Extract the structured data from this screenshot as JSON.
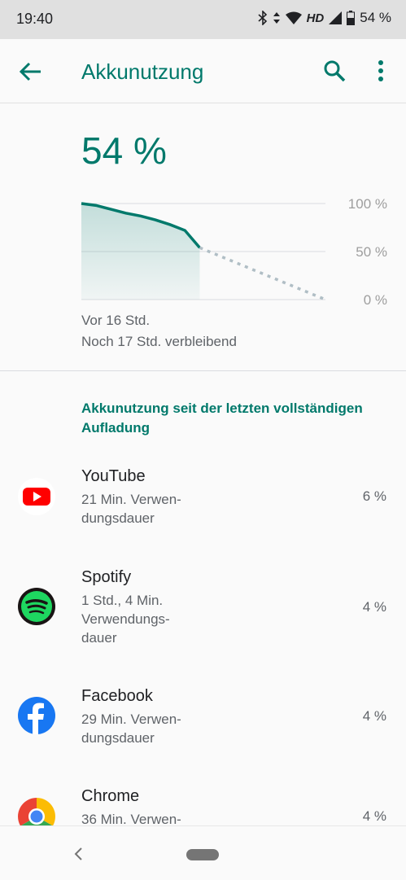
{
  "status_bar": {
    "time": "19:40",
    "hd": "HD",
    "battery": "54 %"
  },
  "app_bar": {
    "title": "Akkunutzung",
    "back_icon": "arrow-back-icon",
    "search_icon": "search-icon",
    "more_icon": "more-vert-icon"
  },
  "battery": {
    "level": "54 %",
    "chart_since": "Vor 16 Std.",
    "chart_remaining": "Noch 17 Std. verbleibend",
    "y_ticks": [
      "100 %",
      "50 %",
      "0 %"
    ]
  },
  "chart_data": {
    "type": "line",
    "x": [
      0,
      2,
      4,
      6,
      8,
      10,
      12,
      14,
      16,
      33
    ],
    "series": [
      {
        "values": [
          100,
          98,
          94,
          90,
          87,
          83,
          78,
          72,
          54,
          null
        ]
      },
      {
        "values": [
          null,
          null,
          null,
          null,
          null,
          null,
          null,
          null,
          54,
          0
        ]
      }
    ],
    "ylim": [
      0,
      100
    ],
    "y_ticks": [
      "100 %",
      "50 %",
      "0 %"
    ],
    "xlabel": "Vor 16 Std.",
    "grid": true
  },
  "usage": {
    "section_title": "Akkunutzung seit der letzten vollständigen Aufladung",
    "apps": [
      {
        "name": "YouTube",
        "sub": "21 Min. Verwen-dungsdauer",
        "percent": "6 %",
        "icon": "youtube-icon"
      },
      {
        "name": "Spotify",
        "sub": "1 Std., 4 Min. Verwendungs-dauer",
        "percent": "4 %",
        "icon": "spotify-icon"
      },
      {
        "name": "Facebook",
        "sub": "29 Min. Verwen-dungsdauer",
        "percent": "4 %",
        "icon": "facebook-icon"
      },
      {
        "name": "Chrome",
        "sub": "36 Min. Verwen-",
        "percent": "4 %",
        "icon": "chrome-icon"
      }
    ]
  },
  "nav_bar": {
    "back_icon": "nav-back-icon",
    "home_icon": "home-pill-icon"
  },
  "colors": {
    "accent": "#00796b",
    "status_bar": "#e0e0e0",
    "background": "#fafafa"
  }
}
